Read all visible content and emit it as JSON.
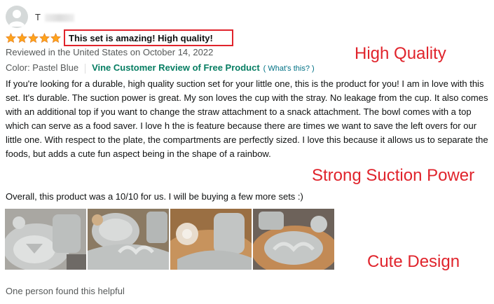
{
  "review": {
    "reviewer_name": "T",
    "rating": 5,
    "title": "This set is amazing! High quality!",
    "reviewed_in": "Reviewed in the United States on October 14, 2022",
    "color_label": "Color: Pastel Blue",
    "vine_label": "Vine Customer Review of Free Product",
    "whats_this": "( What's this? )",
    "body": "If you're looking for a durable, high quality suction set for your little one, this is the product for you! I am in love with this set. It's durable. The suction power is great. My son loves the cup with the stray. No leakage from the cup. It also comes with an additional top if you want to change the straw attachment to a snack attachment. The bowl comes with a top which can serve as a food saver. I love h the is feature because there are times we want to save the left overs for our little one. With respect to the plate, the compartments are perfectly sized. I love this because it allows us to separate the foods, but adds a cute fun aspect being in the shape of a rainbow.",
    "overall": "Overall, this product was a 10/10 for us. I will be buying a few more sets :)",
    "helpful": "One person found this helpful"
  },
  "annotations": {
    "high_quality": "High Quality",
    "strong_suction": "Strong Suction Power",
    "cute_design": "Cute Design"
  },
  "icons": {
    "avatar": "user-avatar-icon",
    "star": "star-icon"
  },
  "colors": {
    "star": "#ffa41c",
    "vine": "#067d62",
    "link": "#007185",
    "annotation_red": "#e0242c"
  }
}
